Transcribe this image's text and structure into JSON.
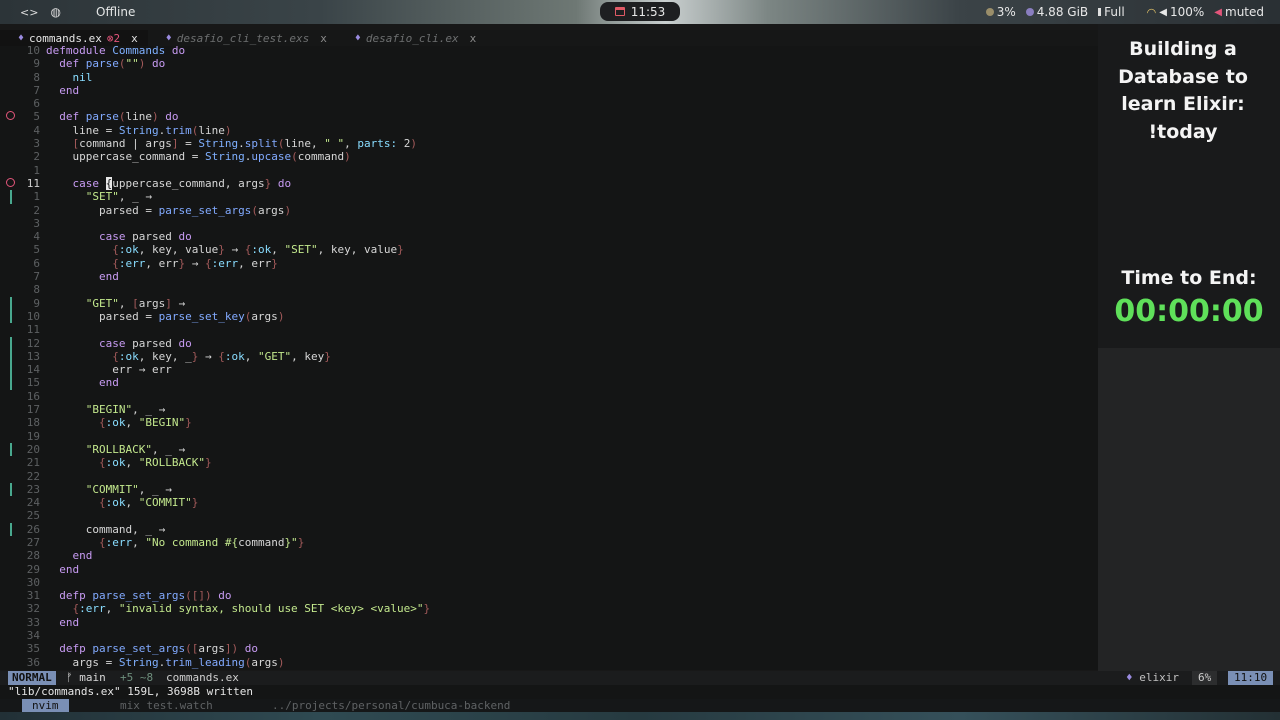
{
  "topbar": {
    "left_icon_1": "code-icon",
    "left_icon_2": "globe-icon",
    "network": "Offline",
    "clock": "11:53",
    "cpu": "3%",
    "memory": "4.88 GiB",
    "battery": "Full",
    "volume": "100%",
    "mic": "muted"
  },
  "tabs": [
    {
      "label": "commands.ex",
      "errors": "2",
      "close": "x",
      "active": true
    },
    {
      "label": "desafio_cli_test.exs",
      "close": "x",
      "active": false
    },
    {
      "label": "desafio_cli.ex",
      "close": "x",
      "active": false
    }
  ],
  "code_lines": [
    {
      "n": "10",
      "rel": false,
      "sign": false,
      "git": false,
      "html": "<span class=\"kw\">defmodule</span> <span class=\"mod\">Commands</span> <span class=\"kw\">do</span>"
    },
    {
      "n": "9",
      "sign": false,
      "git": false,
      "html": "  <span class=\"kw\">def</span> <span class=\"fn\">parse</span><span class=\"brk\">(</span><span class=\"str\">\"\"</span><span class=\"brk\">)</span> <span class=\"kw\">do</span>"
    },
    {
      "n": "8",
      "sign": false,
      "git": false,
      "html": "    <span class=\"atom\">nil</span>"
    },
    {
      "n": "7",
      "sign": false,
      "git": false,
      "html": "  <span class=\"kw\">end</span>"
    },
    {
      "n": "6",
      "sign": false,
      "git": false,
      "html": ""
    },
    {
      "n": "5",
      "sign": true,
      "git": false,
      "html": "  <span class=\"kw\">def</span> <span class=\"fn\">parse</span><span class=\"brk\">(</span>line<span class=\"brk\">)</span> <span class=\"kw\">do</span>"
    },
    {
      "n": "4",
      "sign": false,
      "git": false,
      "html": "    line = <span class=\"mod\">String</span>.<span class=\"fn\">trim</span><span class=\"brk\">(</span>line<span class=\"brk\">)</span>"
    },
    {
      "n": "3",
      "sign": false,
      "git": false,
      "html": "    <span class=\"brk\">[</span>command | args<span class=\"brk\">]</span> = <span class=\"mod\">String</span>.<span class=\"fn\">split</span><span class=\"brk\">(</span>line, <span class=\"str\">\" \"</span>, <span class=\"atom\">parts:</span> 2<span class=\"brk\">)</span>"
    },
    {
      "n": "2",
      "sign": false,
      "git": false,
      "html": "    uppercase_command = <span class=\"mod\">String</span>.<span class=\"fn\">upcase</span><span class=\"brk\">(</span>command<span class=\"brk\">)</span>"
    },
    {
      "n": "1",
      "sign": false,
      "git": false,
      "html": ""
    },
    {
      "n": "11",
      "cur": true,
      "sign": true,
      "git": false,
      "html": "    <span class=\"kw\">case</span> <span class=\"cursor\">{</span>uppercase_command, args<span class=\"brk\">}</span> <span class=\"kw\">do</span>"
    },
    {
      "n": "1",
      "sign": false,
      "git": true,
      "html": "      <span class=\"str\">\"SET\"</span>, _ → "
    },
    {
      "n": "2",
      "sign": false,
      "git": false,
      "html": "        parsed = <span class=\"fn\">parse_set_args</span><span class=\"brk\">(</span>args<span class=\"brk\">)</span>"
    },
    {
      "n": "3",
      "sign": false,
      "git": false,
      "html": ""
    },
    {
      "n": "4",
      "sign": false,
      "git": false,
      "html": "        <span class=\"kw\">case</span> parsed <span class=\"kw\">do</span>"
    },
    {
      "n": "5",
      "sign": false,
      "git": false,
      "html": "          <span class=\"brk\">{</span><span class=\"atom\">:ok</span>, key, value<span class=\"brk\">}</span> → <span class=\"brk\">{</span><span class=\"atom\">:ok</span>, <span class=\"str\">\"SET\"</span>, key, value<span class=\"brk\">}</span>"
    },
    {
      "n": "6",
      "sign": false,
      "git": false,
      "html": "          <span class=\"brk\">{</span><span class=\"atom\">:err</span>, err<span class=\"brk\">}</span> → <span class=\"brk\">{</span><span class=\"atom\">:err</span>, err<span class=\"brk\">}</span>"
    },
    {
      "n": "7",
      "sign": false,
      "git": false,
      "html": "        <span class=\"kw\">end</span>"
    },
    {
      "n": "8",
      "sign": false,
      "git": false,
      "html": ""
    },
    {
      "n": "9",
      "sign": false,
      "git": true,
      "html": "      <span class=\"str\">\"GET\"</span>, <span class=\"brk\">[</span>args<span class=\"brk\">]</span> → "
    },
    {
      "n": "10",
      "sign": false,
      "git": true,
      "html": "        parsed = <span class=\"fn\">parse_set_key</span><span class=\"brk\">(</span>args<span class=\"brk\">)</span>"
    },
    {
      "n": "11",
      "sign": false,
      "git": false,
      "html": ""
    },
    {
      "n": "12",
      "sign": false,
      "git": true,
      "html": "        <span class=\"kw\">case</span> parsed <span class=\"kw\">do</span>"
    },
    {
      "n": "13",
      "sign": false,
      "git": true,
      "html": "          <span class=\"brk\">{</span><span class=\"atom\">:ok</span>, key, _<span class=\"brk\">}</span> → <span class=\"brk\">{</span><span class=\"atom\">:ok</span>, <span class=\"str\">\"GET\"</span>, key<span class=\"brk\">}</span>"
    },
    {
      "n": "14",
      "sign": false,
      "git": true,
      "html": "          err → err"
    },
    {
      "n": "15",
      "sign": false,
      "git": true,
      "html": "        <span class=\"kw\">end</span>"
    },
    {
      "n": "16",
      "sign": false,
      "git": false,
      "html": ""
    },
    {
      "n": "17",
      "sign": false,
      "git": false,
      "html": "      <span class=\"str\">\"BEGIN\"</span>, _ → "
    },
    {
      "n": "18",
      "sign": false,
      "git": false,
      "html": "        <span class=\"brk\">{</span><span class=\"atom\">:ok</span>, <span class=\"str\">\"BEGIN\"</span><span class=\"brk\">}</span>"
    },
    {
      "n": "19",
      "sign": false,
      "git": false,
      "html": ""
    },
    {
      "n": "20",
      "sign": false,
      "git": true,
      "html": "      <span class=\"str\">\"ROLLBACK\"</span>, _ → "
    },
    {
      "n": "21",
      "sign": false,
      "git": false,
      "html": "        <span class=\"brk\">{</span><span class=\"atom\">:ok</span>, <span class=\"str\">\"ROLLBACK\"</span><span class=\"brk\">}</span>"
    },
    {
      "n": "22",
      "sign": false,
      "git": false,
      "html": ""
    },
    {
      "n": "23",
      "sign": false,
      "git": true,
      "html": "      <span class=\"str\">\"COMMIT\"</span>, _ → "
    },
    {
      "n": "24",
      "sign": false,
      "git": false,
      "html": "        <span class=\"brk\">{</span><span class=\"atom\">:ok</span>, <span class=\"str\">\"COMMIT\"</span><span class=\"brk\">}</span>"
    },
    {
      "n": "25",
      "sign": false,
      "git": false,
      "html": ""
    },
    {
      "n": "26",
      "sign": false,
      "git": true,
      "html": "      command, _ → "
    },
    {
      "n": "27",
      "sign": false,
      "git": false,
      "html": "        <span class=\"brk\">{</span><span class=\"atom\">:err</span>, <span class=\"str\">\"No command #{</span>command<span class=\"str\">}\"</span><span class=\"brk\">}</span>"
    },
    {
      "n": "28",
      "sign": false,
      "git": false,
      "html": "    <span class=\"kw\">end</span>"
    },
    {
      "n": "29",
      "sign": false,
      "git": false,
      "html": "  <span class=\"kw\">end</span>"
    },
    {
      "n": "30",
      "sign": false,
      "git": false,
      "html": ""
    },
    {
      "n": "31",
      "sign": false,
      "git": false,
      "html": "  <span class=\"kw\">defp</span> <span class=\"fn\">parse_set_args</span><span class=\"brk\">(</span><span class=\"brk\">[]</span><span class=\"brk\">)</span> <span class=\"kw\">do</span>"
    },
    {
      "n": "32",
      "sign": false,
      "git": false,
      "html": "    <span class=\"brk\">{</span><span class=\"atom\">:err</span>, <span class=\"str\">\"invalid syntax, should use SET &lt;key&gt; &lt;value&gt;\"</span><span class=\"brk\">}</span>"
    },
    {
      "n": "33",
      "sign": false,
      "git": false,
      "html": "  <span class=\"kw\">end</span>"
    },
    {
      "n": "34",
      "sign": false,
      "git": false,
      "html": ""
    },
    {
      "n": "35",
      "sign": false,
      "git": false,
      "html": "  <span class=\"kw\">defp</span> <span class=\"fn\">parse_set_args</span><span class=\"brk\">(</span><span class=\"brk\">[</span>args<span class=\"brk\">]</span><span class=\"brk\">)</span> <span class=\"kw\">do</span>"
    },
    {
      "n": "36",
      "sign": false,
      "git": false,
      "html": "    args = <span class=\"mod\">String</span>.<span class=\"fn\">trim_leading</span><span class=\"brk\">(</span>args<span class=\"brk\">)</span>"
    }
  ],
  "statusline": {
    "mode": "NORMAL",
    "branch": "ᚠ main",
    "diff": "+5 ~8",
    "file": "commands.ex",
    "filetype": "elixir",
    "percent": "6%",
    "position": "11:10"
  },
  "cmdline": "\"lib/commands.ex\" 159L, 3698B written",
  "tmux": {
    "window1": "nvim",
    "window2": "mix test.watch",
    "window3": "../projects/personal/cumbuca-backend"
  },
  "overlay": {
    "title": "Building a Database to learn Elixir: !today",
    "timer_label": "Time to End:",
    "timer_value": "00:00:00"
  },
  "colors": {
    "accent": "#7a8fb5",
    "error": "#e2557a",
    "timer": "#5fe05a"
  }
}
